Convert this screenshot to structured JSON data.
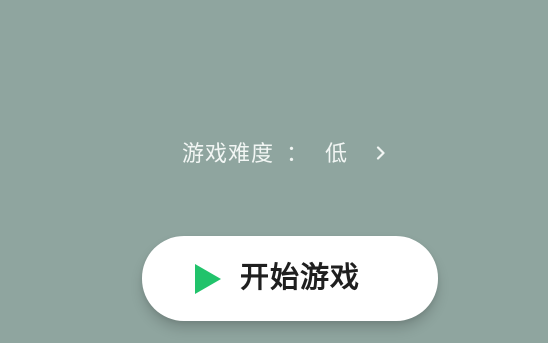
{
  "difficulty": {
    "label": "游戏难度",
    "colon": "：",
    "value": "低",
    "chevron_icon": "chevron-right-icon"
  },
  "start_button": {
    "label": "开始游戏",
    "icon": "play-icon",
    "icon_color": "#21c36b"
  },
  "colors": {
    "background": "#8fa59f",
    "button_background": "#ffffff",
    "text_light": "#f2f6f4",
    "text_dark": "#1f1f1f",
    "accent": "#21c36b"
  }
}
